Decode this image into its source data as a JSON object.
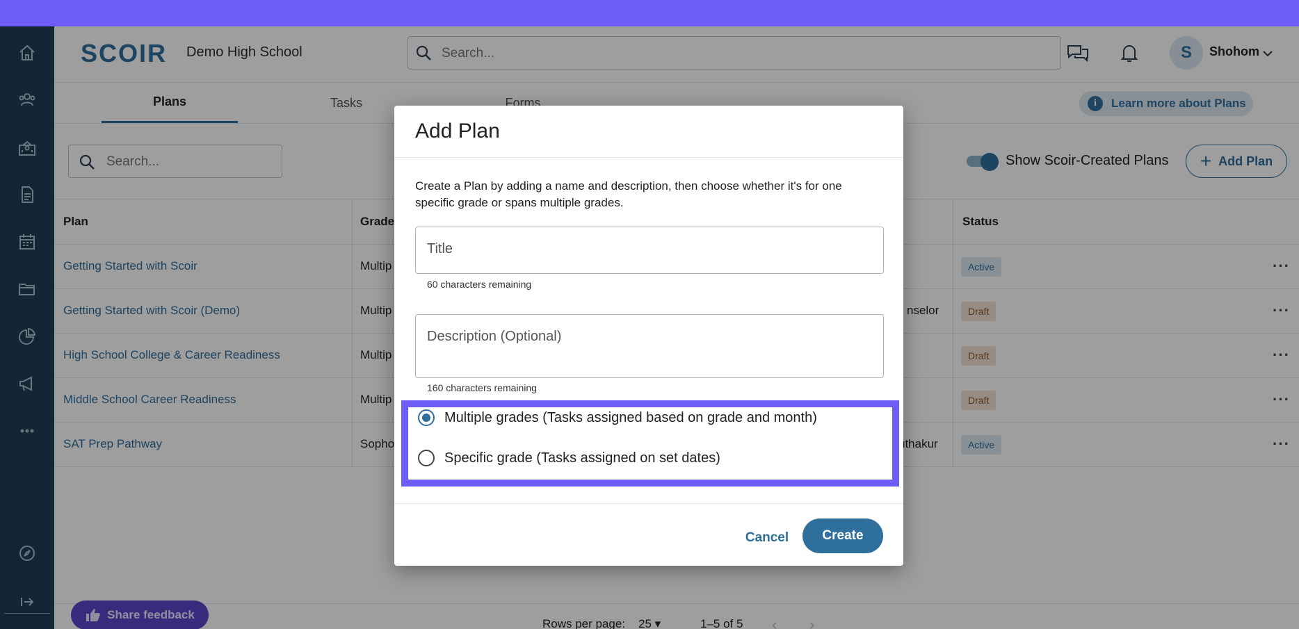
{
  "app": {
    "logo": "SCOIR",
    "school": "Demo High School",
    "search_placeholder": "Search...",
    "user_initial": "S",
    "user_name": "Shohom"
  },
  "tabs": [
    {
      "label": "Plans",
      "active": true
    },
    {
      "label": "Tasks",
      "active": false
    },
    {
      "label": "Forms",
      "active": false
    }
  ],
  "learn_more": "Learn more about Plans",
  "toolbar": {
    "search_placeholder": "Search...",
    "toggle_label": "Show Scoir-Created Plans",
    "toggle_on": true,
    "add_plan": "Add Plan"
  },
  "table": {
    "headers": {
      "plan": "Plan",
      "grade": "Grade",
      "status": "Status"
    },
    "rows": [
      {
        "plan": "Getting Started with Scoir",
        "grade": "Multip",
        "owner": "",
        "status": "Active"
      },
      {
        "plan": "Getting Started with Scoir (Demo)",
        "grade": "Multip",
        "owner": "nselor",
        "status": "Draft"
      },
      {
        "plan": "High School College & Career Readiness",
        "grade": "Multip",
        "owner": "",
        "status": "Draft"
      },
      {
        "plan": "Middle School Career Readiness",
        "grade": "Multip",
        "owner": "",
        "status": "Draft"
      },
      {
        "plan": "SAT Prep Pathway",
        "grade": "Sopho",
        "owner": "uthakur",
        "status": "Active"
      }
    ]
  },
  "pagination": {
    "rows_per_page_label": "Rows per page:",
    "rows_per_page": "25",
    "range": "1–5 of 5"
  },
  "feedback": "Share feedback",
  "modal": {
    "title": "Add Plan",
    "description": "Create a Plan by adding a name and description, then choose whether it's for one specific grade or spans multiple grades.",
    "title_placeholder": "Title",
    "title_helper": "60 characters remaining",
    "desc_placeholder": "Description (Optional)",
    "desc_helper": "160 characters remaining",
    "options": [
      {
        "label": "Multiple grades (Tasks assigned based on grade and month)",
        "checked": true
      },
      {
        "label": "Specific grade (Tasks assigned on set dates)",
        "checked": false
      }
    ],
    "cancel": "Cancel",
    "create": "Create"
  },
  "colors": {
    "accent": "#2f6f9c",
    "sidebar": "#1d3e55",
    "highlight": "#6d5cf6"
  }
}
